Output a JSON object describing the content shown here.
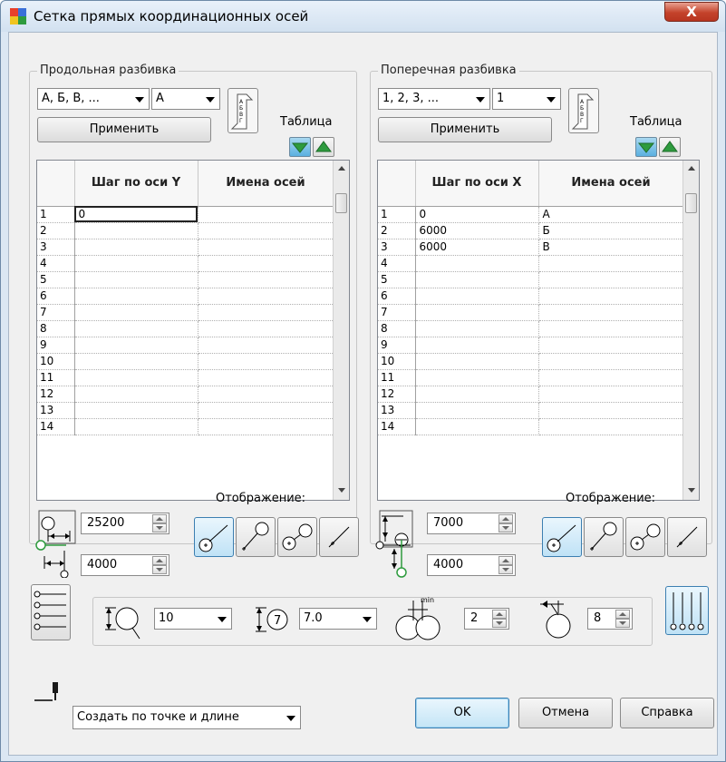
{
  "window": {
    "title": "Сетка прямых координационных осей",
    "close_label": "X"
  },
  "left": {
    "group_title": "Продольная разбивка",
    "scheme_value": "А, Б, В, ...",
    "start_value": "А",
    "apply_label": "Применить",
    "table_label": "Таблица",
    "col_step": "Шаг по оси Y",
    "col_names": "Имена осей",
    "rows": [
      {
        "n": "1",
        "step": "0",
        "name": ""
      },
      {
        "n": "2",
        "step": "",
        "name": ""
      },
      {
        "n": "3",
        "step": "",
        "name": ""
      },
      {
        "n": "4",
        "step": "",
        "name": ""
      },
      {
        "n": "5",
        "step": "",
        "name": ""
      },
      {
        "n": "6",
        "step": "",
        "name": ""
      },
      {
        "n": "7",
        "step": "",
        "name": ""
      },
      {
        "n": "8",
        "step": "",
        "name": ""
      },
      {
        "n": "9",
        "step": "",
        "name": ""
      },
      {
        "n": "10",
        "step": "",
        "name": ""
      },
      {
        "n": "11",
        "step": "",
        "name": ""
      },
      {
        "n": "12",
        "step": "",
        "name": ""
      },
      {
        "n": "13",
        "step": "",
        "name": ""
      },
      {
        "n": "14",
        "step": "",
        "name": ""
      }
    ],
    "spin1": "25200",
    "spin2": "4000",
    "display_label": "Отображение:"
  },
  "right": {
    "group_title": "Поперечная разбивка",
    "scheme_value": "1, 2, 3, ...",
    "start_value": "1",
    "apply_label": "Применить",
    "table_label": "Таблица",
    "col_step": "Шаг по оси X",
    "col_names": "Имена осей",
    "rows": [
      {
        "n": "1",
        "step": "0",
        "name": "А"
      },
      {
        "n": "2",
        "step": "6000",
        "name": "Б"
      },
      {
        "n": "3",
        "step": "6000",
        "name": "В"
      },
      {
        "n": "4",
        "step": "",
        "name": ""
      },
      {
        "n": "5",
        "step": "",
        "name": ""
      },
      {
        "n": "6",
        "step": "",
        "name": ""
      },
      {
        "n": "7",
        "step": "",
        "name": ""
      },
      {
        "n": "8",
        "step": "",
        "name": ""
      },
      {
        "n": "9",
        "step": "",
        "name": ""
      },
      {
        "n": "10",
        "step": "",
        "name": ""
      },
      {
        "n": "11",
        "step": "",
        "name": ""
      },
      {
        "n": "12",
        "step": "",
        "name": ""
      },
      {
        "n": "13",
        "step": "",
        "name": ""
      },
      {
        "n": "14",
        "step": "",
        "name": ""
      }
    ],
    "spin1": "7000",
    "spin2": "4000",
    "display_label": "Отображение:"
  },
  "bottom": {
    "circle_size": "10",
    "text_size": "7.0",
    "min_value": "2",
    "count_value": "8",
    "min_label": "min",
    "bubble_text": "7"
  },
  "footer": {
    "mode_value": "Создать по точке и длине",
    "ok_label": "OK",
    "cancel_label": "Отмена",
    "help_label": "Справка"
  },
  "colors": {
    "accent_green": "#2e9b3e",
    "accent_blue": "#3c7fb1",
    "close_red": "#c4432b"
  }
}
